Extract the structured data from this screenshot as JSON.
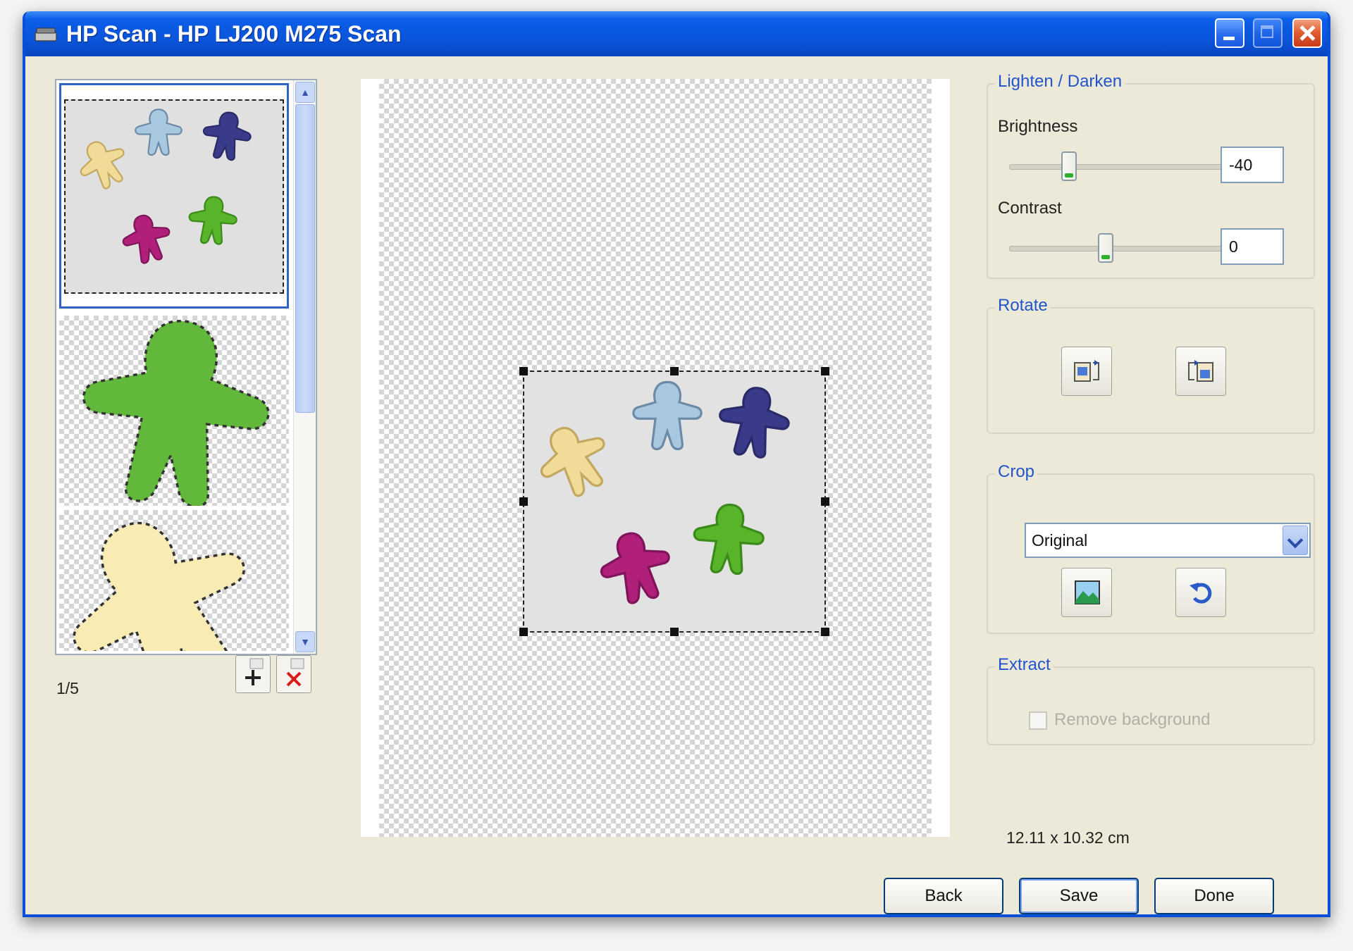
{
  "window": {
    "title": "HP Scan - HP LJ200 M275 Scan"
  },
  "thumbnails": {
    "page_count": "1/5",
    "items": [
      {
        "name": "all-figures",
        "selected": true
      },
      {
        "name": "green-figure",
        "selected": false
      },
      {
        "name": "yellow-figure",
        "selected": false
      }
    ]
  },
  "lighten_darken": {
    "title": "Lighten / Darken",
    "brightness_label": "Brightness",
    "brightness_value": "-40",
    "contrast_label": "Contrast",
    "contrast_value": "0"
  },
  "rotate": {
    "title": "Rotate"
  },
  "crop": {
    "title": "Crop",
    "selected_option": "Original"
  },
  "extract": {
    "title": "Extract",
    "remove_background_label": "Remove background",
    "remove_background_checked": false
  },
  "status": {
    "dimensions": "12.11 x 10.32 cm"
  },
  "footer": {
    "back_label": "Back",
    "save_label": "Save",
    "done_label": "Done"
  },
  "colors": {
    "titlebar": "#0a55dc",
    "group_title": "#2255cc",
    "figure_green": "#58b52a",
    "figure_magenta": "#b0207a",
    "figure_navy": "#3a3a8a",
    "figure_lightblue": "#a8c8e0",
    "figure_yellow": "#f0dc98"
  }
}
